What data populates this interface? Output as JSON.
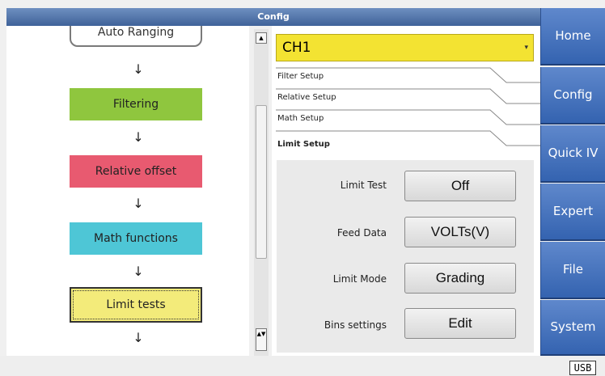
{
  "window": {
    "title": "Config"
  },
  "flow": {
    "items": [
      {
        "label": "Auto Ranging",
        "color": "#ffffff"
      },
      {
        "label": "Filtering",
        "color": "#8fc63e"
      },
      {
        "label": "Relative offset",
        "color": "#e85a70"
      },
      {
        "label": "Math functions",
        "color": "#4ec6d6"
      },
      {
        "label": "Limit tests",
        "color": "#f3eb7a"
      }
    ],
    "arrow": "↓"
  },
  "scrollbar": {
    "up_icon": "▲",
    "down_icon": "▲▼"
  },
  "channel": {
    "value": "CH1",
    "dropdown_icon": "▾"
  },
  "tabs": [
    {
      "label": "Filter Setup"
    },
    {
      "label": "Relative Setup"
    },
    {
      "label": "Math Setup"
    },
    {
      "label": "Limit Setup",
      "active": true
    }
  ],
  "limit_setup": {
    "rows": [
      {
        "label": "Limit Test",
        "value": "Off"
      },
      {
        "label": "Feed Data",
        "value": "VOLTs(V)"
      },
      {
        "label": "Limit Mode",
        "value": "Grading"
      },
      {
        "label": "Bins settings",
        "value": "Edit"
      }
    ]
  },
  "nav": [
    {
      "label": "Home"
    },
    {
      "label": "Config"
    },
    {
      "label": "Quick IV"
    },
    {
      "label": "Expert"
    },
    {
      "label": "File"
    },
    {
      "label": "System"
    }
  ],
  "status": {
    "usb": "USB"
  },
  "colors": {
    "nav": "#3f6eba",
    "title": "#4f72aa",
    "channel_select": "#f3e332"
  }
}
